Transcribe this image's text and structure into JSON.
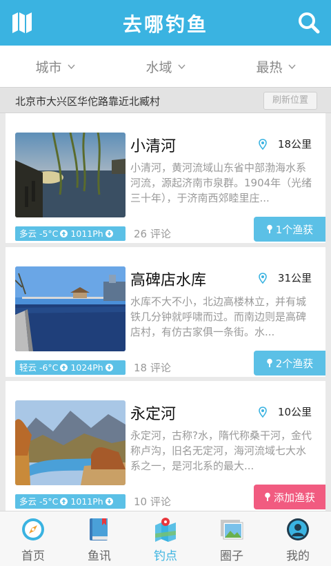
{
  "app": {
    "title": "去哪钓鱼"
  },
  "filters": [
    {
      "label": "城市",
      "icon": "chevron-down-icon"
    },
    {
      "label": "水域",
      "icon": "chevron-down-icon"
    },
    {
      "label": "最热",
      "icon": "chevron-down-icon"
    }
  ],
  "location": {
    "text": "北京市大兴区华佗路靠近北臧村",
    "refresh_label": "刷新位置"
  },
  "spots": [
    {
      "name": "小清河",
      "distance": "18公里",
      "description": "小清河，黄河流域山东省中部渤海水系河流，源起济南市泉群。1904年（光绪三十年），于济南西郊睦里庄...",
      "weather": "多云  -5°C",
      "pressure": "1011Ph",
      "comments": "26 评论",
      "catch_label": "1个渔获",
      "catch_color": "#5bc0e6"
    },
    {
      "name": "高碑店水库",
      "distance": "31公里",
      "description": "水库不大不小，北边高楼林立，并有城铁几分钟就呼啸而过。而南边则是高碑店村，有仿古家俱一条街。水...",
      "weather": "轻云  -6°C",
      "pressure": "1024Ph",
      "comments": "18 评论",
      "catch_label": "2个渔获",
      "catch_color": "#5bc0e6"
    },
    {
      "name": "永定河",
      "distance": "10公里",
      "description": "永定河，古称?水，隋代称桑干河，金代称卢沟，旧名无定河，海河流域七大水系之一，是河北系的最大...",
      "weather": "多云  -5°C",
      "pressure": "1011Ph",
      "comments": "10 评论",
      "catch_label": "添加渔获",
      "catch_color": "#f15b80"
    }
  ],
  "tabs": [
    {
      "label": "首页",
      "icon": "compass-icon",
      "active": false
    },
    {
      "label": "鱼讯",
      "icon": "book-icon",
      "active": false
    },
    {
      "label": "钓点",
      "icon": "map-pin-icon",
      "active": true
    },
    {
      "label": "圈子",
      "icon": "gallery-icon",
      "active": false
    },
    {
      "label": "我的",
      "icon": "avatar-icon",
      "active": false
    }
  ],
  "colors": {
    "primary": "#3ab3e1",
    "accent_pink": "#f15b80",
    "location_red": "#e8383d"
  }
}
